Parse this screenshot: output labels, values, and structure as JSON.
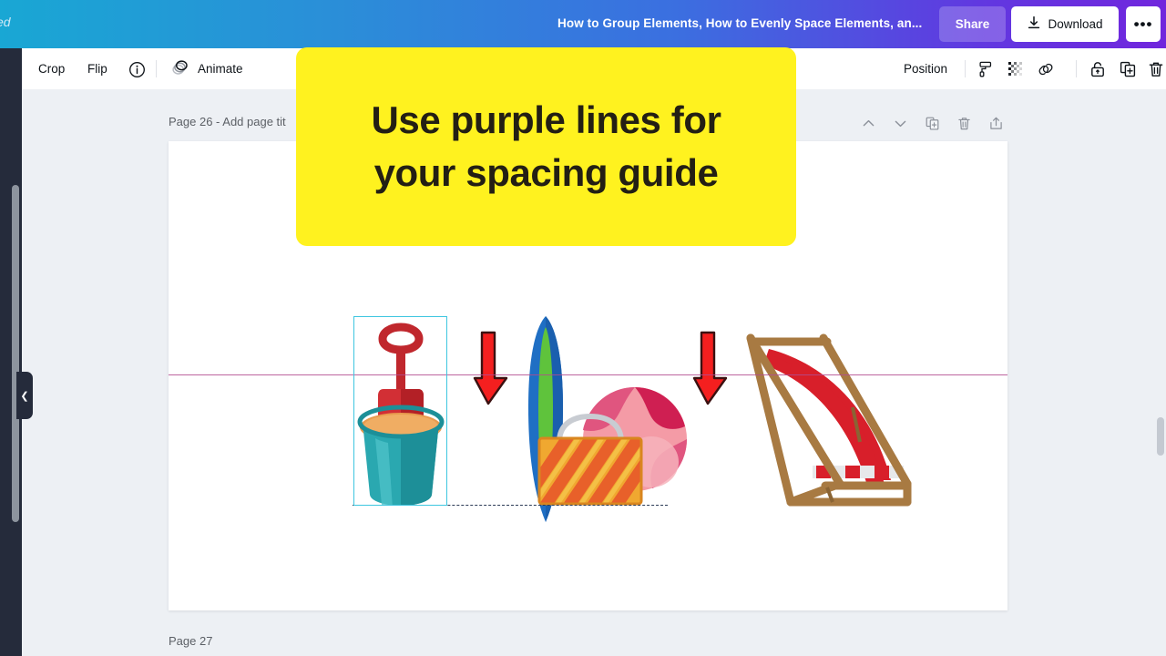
{
  "header": {
    "left_partial_text": "ed",
    "document_title": "How to Group Elements, How to Evenly Space Elements, an...",
    "share_label": "Share",
    "download_label": "Download",
    "more_label": "•••",
    "colors": {
      "gradient_start": "#19a7d4",
      "gradient_mid": "#3b6fe0",
      "gradient_end": "#7126dd",
      "button_text": "#ffffff"
    }
  },
  "toolbar": {
    "crop_label": "Crop",
    "flip_label": "Flip",
    "info_icon": "info-circle-icon",
    "animate_label": "Animate",
    "animate_icon": "animate-circles-icon",
    "position_label": "Position",
    "color_icon": "paint-roller-icon",
    "transparency_icon": "checkerboard-transparency-icon",
    "link_icon": "link-icon",
    "lock_icon": "lock-icon",
    "duplicate_icon": "duplicate-icon",
    "delete_icon": "trash-icon"
  },
  "page": {
    "current_page_label": "Page 26 - Add page tit",
    "next_page_label": "Page 27",
    "actions": {
      "move_up_icon": "chevron-up-icon",
      "move_down_icon": "chevron-down-icon",
      "duplicate_icon": "duplicate-page-icon",
      "delete_icon": "trash-icon",
      "add_page_icon": "add-page-icon"
    }
  },
  "callout": {
    "text": "Use purple lines for your spacing guide",
    "background": "#fff21f",
    "text_color": "#231f14"
  },
  "canvas": {
    "guide_line_color": "#b24b8e",
    "selection_color": "#3ec6e0",
    "dashed_align_color": "#2b3a55",
    "elements": [
      {
        "name": "sand-bucket-with-shovel",
        "selected": true
      },
      {
        "name": "red-down-arrow-left",
        "selected": false
      },
      {
        "name": "surfboard",
        "selected": false
      },
      {
        "name": "beach-bag",
        "selected": false
      },
      {
        "name": "beach-ball",
        "selected": false
      },
      {
        "name": "red-down-arrow-right",
        "selected": false
      },
      {
        "name": "deck-chair",
        "selected": false
      }
    ]
  },
  "sidebar": {
    "collapse_icon": "chevron-left-icon",
    "background": "#252b3b"
  }
}
